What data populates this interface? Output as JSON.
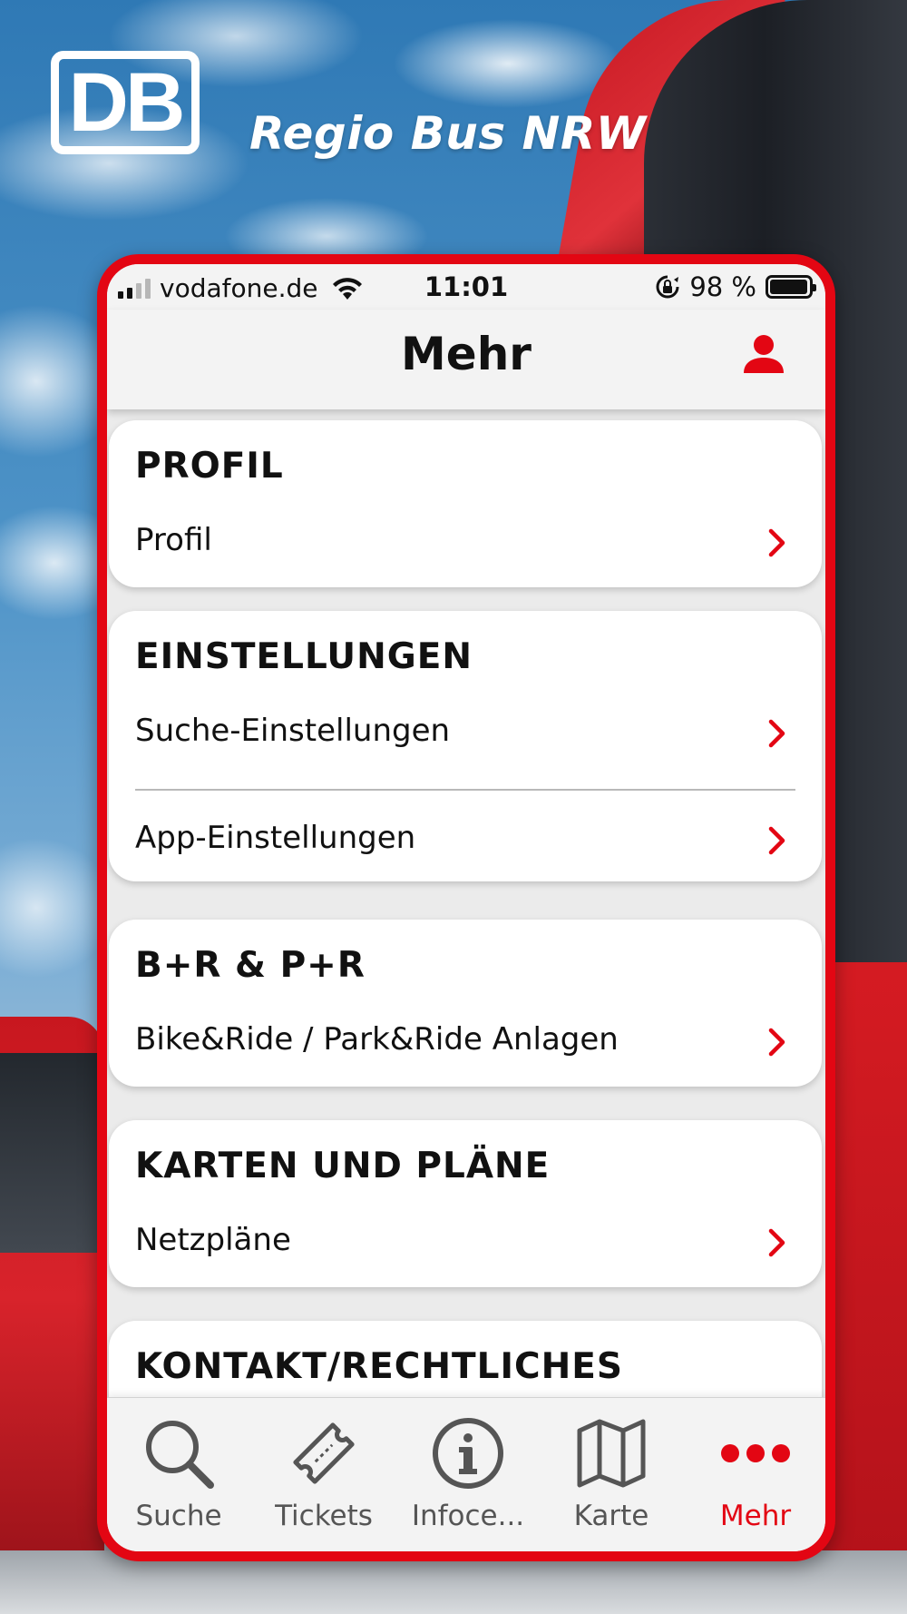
{
  "brand": {
    "logo_text": "DB",
    "title": "Regio Bus NRW"
  },
  "statusbar": {
    "carrier": "vodafone.de",
    "time": "11:01",
    "battery": "98 %",
    "battery_level": 0.98
  },
  "navbar": {
    "title": "Mehr",
    "profile_icon": "person-icon"
  },
  "sections": [
    {
      "title": "PROFIL",
      "items": [
        {
          "label": "Profil"
        }
      ]
    },
    {
      "title": "EINSTELLUNGEN",
      "items": [
        {
          "label": "Suche-Einstellungen"
        },
        {
          "label": "App-Einstellungen"
        }
      ]
    },
    {
      "title": "B+R & P+R",
      "items": [
        {
          "label": "Bike&Ride / Park&Ride Anlagen"
        }
      ]
    },
    {
      "title": "KARTEN UND PLÄNE",
      "items": [
        {
          "label": "Netzpläne"
        }
      ]
    },
    {
      "title": "KONTAKT/RECHTLICHES",
      "items": []
    }
  ],
  "tabbar": {
    "tabs": [
      {
        "label": "Suche",
        "icon": "search-icon",
        "active": false
      },
      {
        "label": "Tickets",
        "icon": "ticket-icon",
        "active": false
      },
      {
        "label": "Infoce...",
        "icon": "info-icon",
        "active": false
      },
      {
        "label": "Karte",
        "icon": "map-icon",
        "active": false
      },
      {
        "label": "Mehr",
        "icon": "more-icon",
        "active": true
      }
    ]
  },
  "colors": {
    "accent": "#e30613",
    "text": "#111111",
    "inactive": "#555555"
  }
}
